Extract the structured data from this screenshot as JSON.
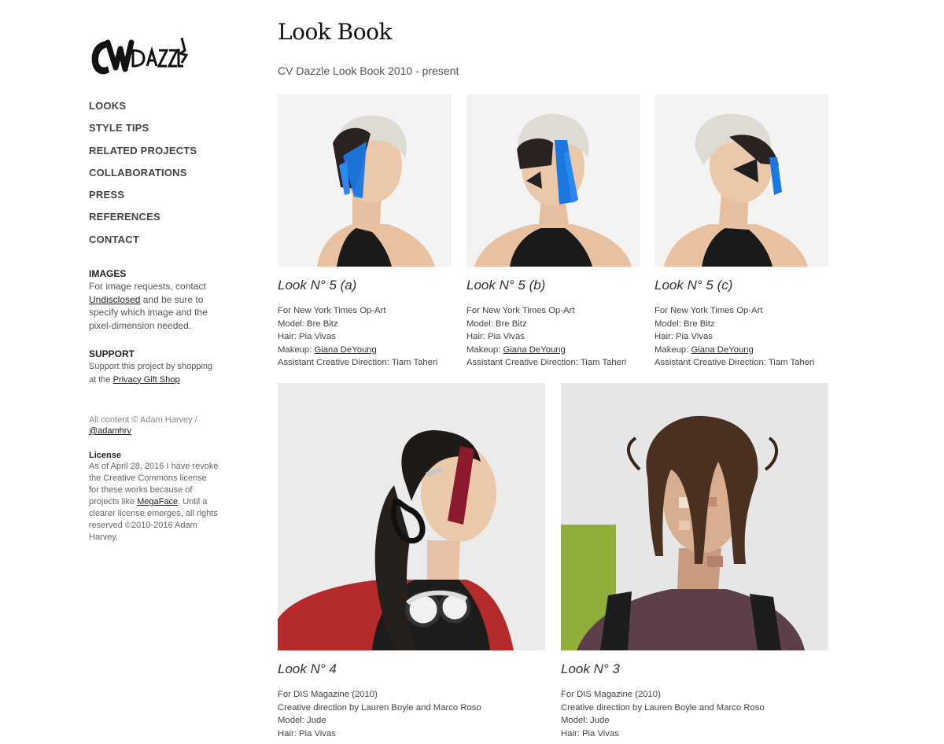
{
  "sidebar": {
    "logo_alt": "CV Dazzle",
    "nav": [
      "LOOKS",
      "STYLE TIPS",
      "RELATED PROJECTS",
      "COLLABORATIONS",
      "PRESS",
      "REFERENCES",
      "CONTACT"
    ],
    "images": {
      "heading": "IMAGES",
      "text_1": "For image requests, contact",
      "link": "Undisclosed",
      "text_2": "and be sure to specify which image and the pixel-dimension needed."
    },
    "support": {
      "heading": "SUPPORT",
      "text": "Support this project by shopping at the",
      "link": "Privacy Gift Shop"
    },
    "copyright": {
      "text": "All content © Adam Harvey /",
      "link": "@adamhrv"
    },
    "license": {
      "heading": "License",
      "text_1": "As of April 28, 2016 I have revoke the Creative Commons license for these works because of projects like",
      "link": "MegaFace",
      "text_2": ". Until a clearer license emerges, all rights reserved ©2010-2016 Adam Harvey."
    }
  },
  "main": {
    "title": "Look Book",
    "subtitle": "CV Dazzle Look Book 2010 - present",
    "looks": [
      {
        "title": "Look N° 5 (a)",
        "for": "For New York Times Op-Art",
        "model": "Model: Bre Bitz",
        "hair": "Hair: Pia Vivas",
        "makeup_label": "Makeup: ",
        "makeup_link": "Giana DeYoung",
        "assistant": "Assistant Creative Direction: Tiam Taheri"
      },
      {
        "title": "Look N° 5 (b)",
        "for": "For New York Times Op-Art",
        "model": "Model: Bre Bitz",
        "hair": "Hair: Pia Vivas",
        "makeup_label": "Makeup: ",
        "makeup_link": "Giana DeYoung",
        "assistant": "Assistant Creative Direction: Tiam Taheri"
      },
      {
        "title": "Look N° 5 (c)",
        "for": "For New York Times Op-Art",
        "model": "Model: Bre Bitz",
        "hair": "Hair: Pia Vivas",
        "makeup_label": "Makeup: ",
        "makeup_link": "Giana DeYoung",
        "assistant": "Assistant Creative Direction: Tiam Taheri"
      },
      {
        "title": "Look N° 4",
        "for": "For DIS Magazine (2010)",
        "direction": "Creative direction by Lauren Boyle and Marco Roso",
        "model": "Model: Jude",
        "hair": "Hair: Pia Vivas"
      },
      {
        "title": "Look N° 3",
        "for": "For DIS Magazine (2010)",
        "direction": "Creative direction by Lauren Boyle and Marco Roso",
        "model": "Model: Jude",
        "hair": "Hair: Pia Vivas"
      }
    ]
  },
  "colors": {
    "text": "#444444",
    "heading": "#111111",
    "accent_blue": "#1a78e0",
    "accent_red": "#8c1a2e",
    "photo_bg": "#f2f2f2"
  }
}
